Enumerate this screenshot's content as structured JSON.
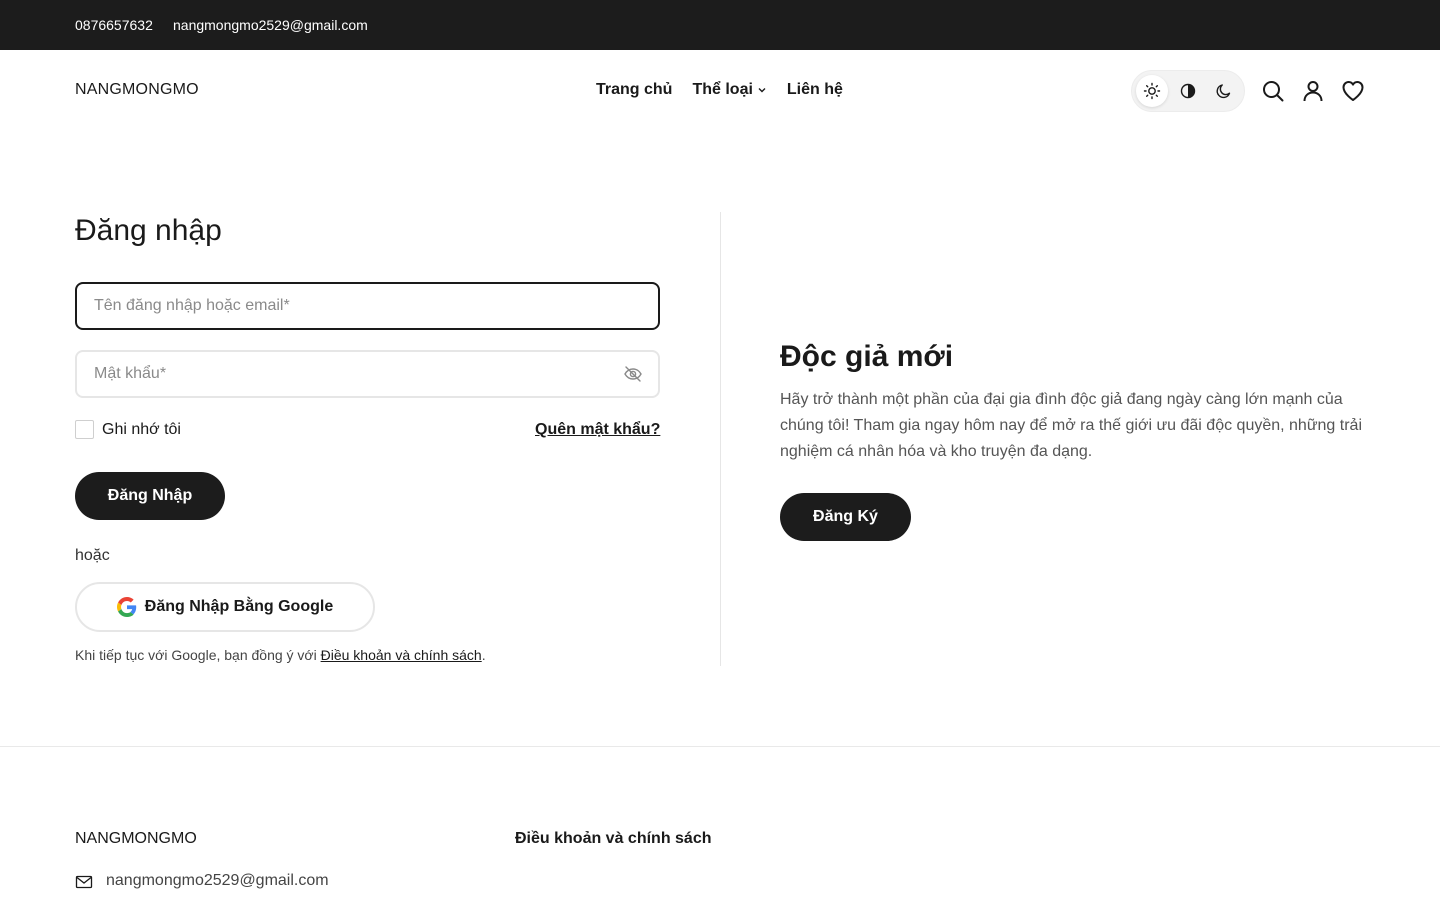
{
  "topbar": {
    "phone": "0876657632",
    "email": "nangmongmo2529@gmail.com"
  },
  "header": {
    "logo": "NANGMONGMO",
    "nav": [
      {
        "label": "Trang chủ"
      },
      {
        "label": "Thể loại",
        "icon": "chevron-down-icon"
      },
      {
        "label": "Liên hệ"
      }
    ],
    "theme": {
      "active": "light",
      "options": [
        "sun-icon",
        "contrast-icon",
        "moon-icon"
      ]
    },
    "icons": [
      "search-icon",
      "user-icon",
      "heart-icon"
    ]
  },
  "login": {
    "title": "Đăng nhập",
    "username_placeholder": "Tên đăng nhập hoặc email*",
    "username_value": "",
    "password_placeholder": "Mật khẩu*",
    "password_value": "",
    "remember_label": "Ghi nhớ tôi",
    "remember_checked": false,
    "forgot_label": "Quên mật khẩu?",
    "submit_label": "Đăng Nhập",
    "or_label": "hoặc",
    "google_label": "Đăng Nhập Bằng Google",
    "terms_prefix": "Khi tiếp tục với Google, bạn đồng ý với ",
    "terms_link": "Điều khoản và chính sách",
    "terms_suffix": "."
  },
  "register": {
    "title": "Độc giả mới",
    "description": "Hãy trở thành một phần của đại gia đình độc giả đang ngày càng lớn mạnh của chúng tôi! Tham gia ngay hôm nay để mở ra thế giới ưu đãi độc quyền, những trải nghiệm cá nhân hóa và kho truyện đa dạng.",
    "button_label": "Đăng Ký"
  },
  "footer": {
    "logo": "NANGMONGMO",
    "terms_label": "Điều khoản và chính sách",
    "email": "nangmongmo2529@gmail.com"
  },
  "colors": {
    "dark": "#1c1c1c",
    "border": "#e6e6e6",
    "text": "#1a1a1a",
    "muted": "#555555"
  }
}
